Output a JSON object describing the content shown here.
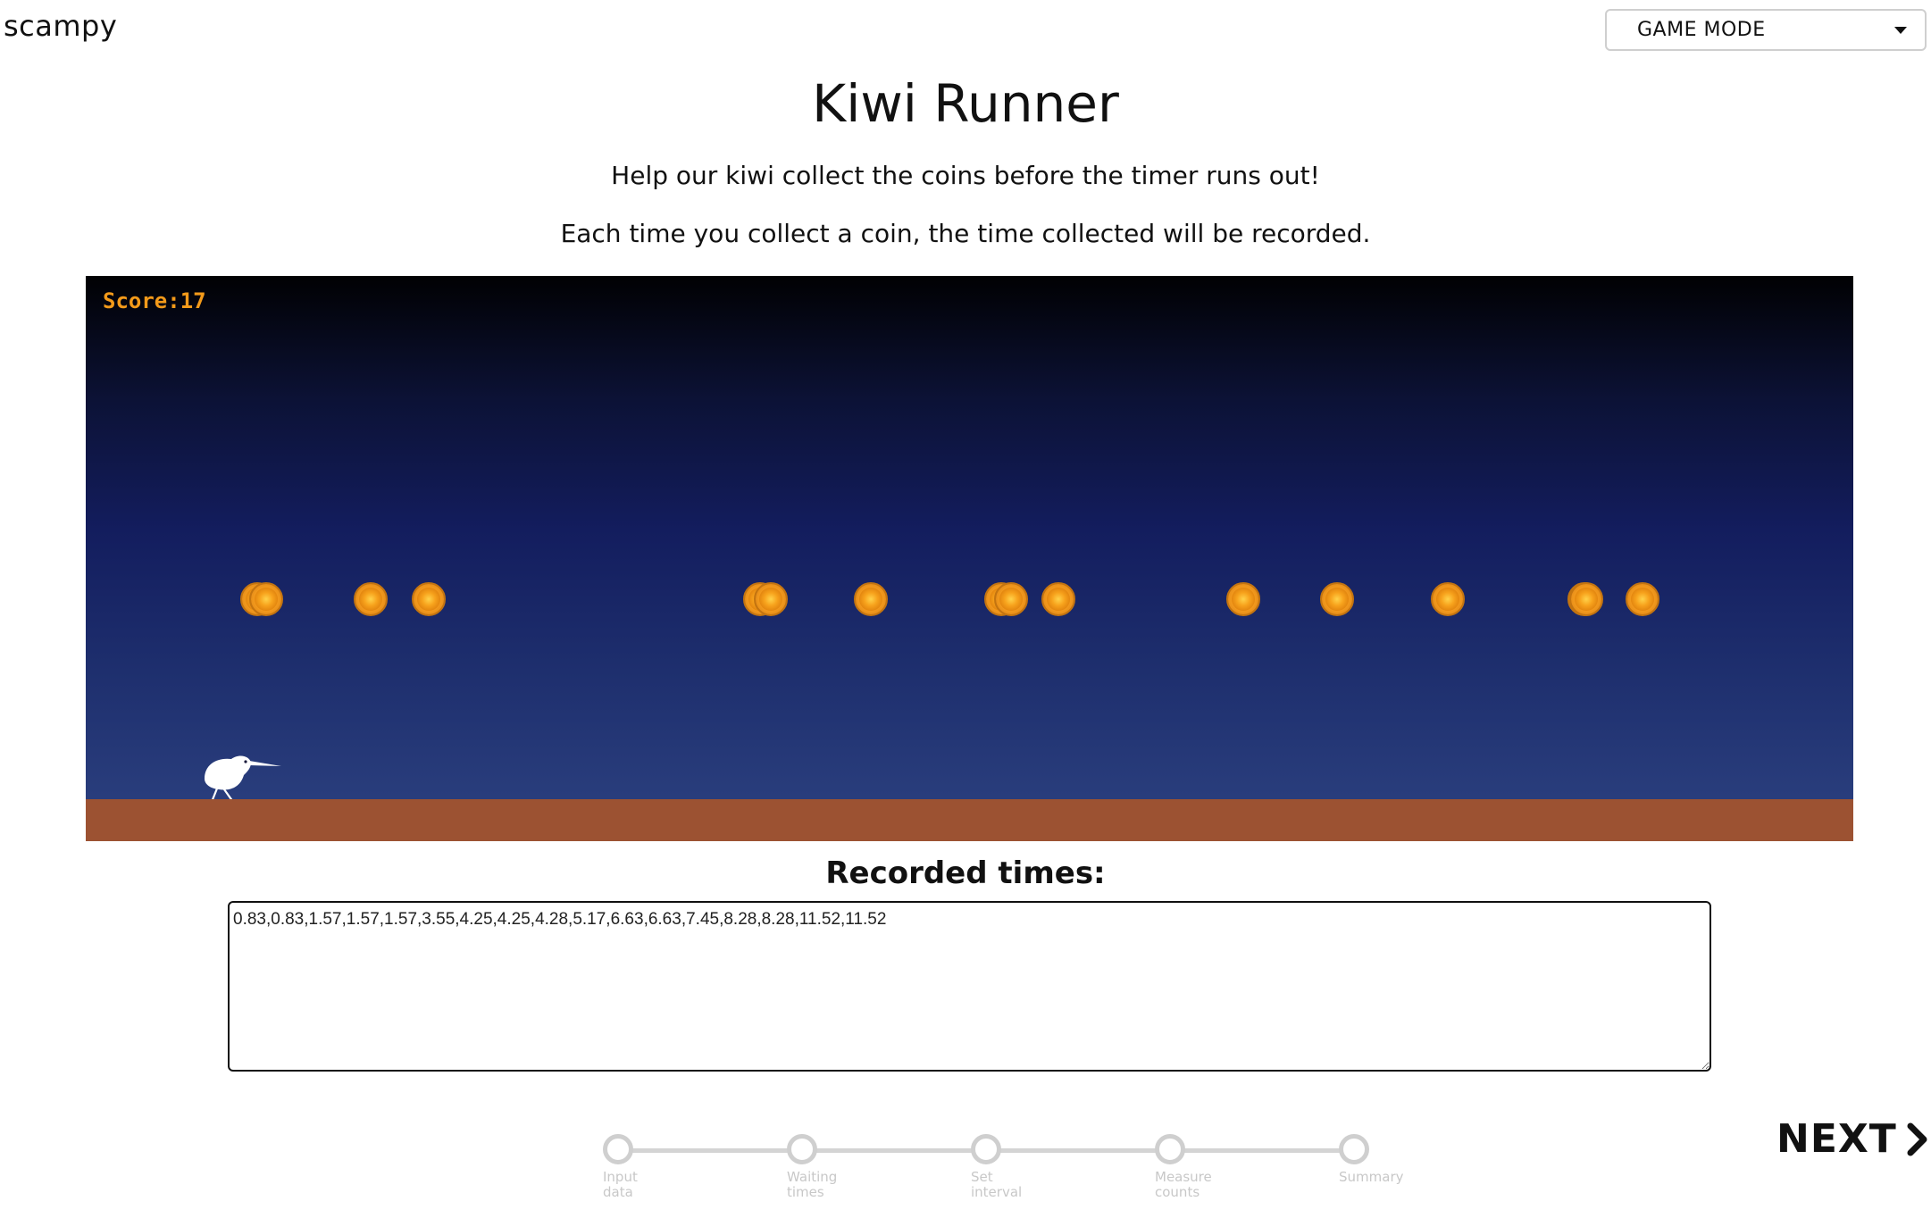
{
  "brand": "scampy",
  "mode_select": {
    "value": "GAME MODE"
  },
  "title": "Kiwi Runner",
  "intro_line_1": "Help our kiwi collect the coins before the timer runs out!",
  "intro_line_2": "Each time you collect a coin, the time collected will be recorded.",
  "game": {
    "score_label": "Score:17",
    "sky_colors": [
      "#010103",
      "#131d5e",
      "#2d4281"
    ],
    "ground_color": "#9c5232",
    "coin_color": "#f7a21c",
    "coin_count_visible": 19
  },
  "recorded_label": "Recorded times:",
  "recorded_times": "0.83,0.83,1.57,1.57,1.57,3.55,4.25,4.25,4.28,5.17,6.63,6.63,7.45,8.28,8.28,11.52,11.52",
  "steps": [
    {
      "label": "Input\ndata"
    },
    {
      "label": "Waiting\ntimes"
    },
    {
      "label": "Set\ninterval"
    },
    {
      "label": "Measure\ncounts"
    },
    {
      "label": "Summary"
    }
  ],
  "next_label": "NEXT"
}
